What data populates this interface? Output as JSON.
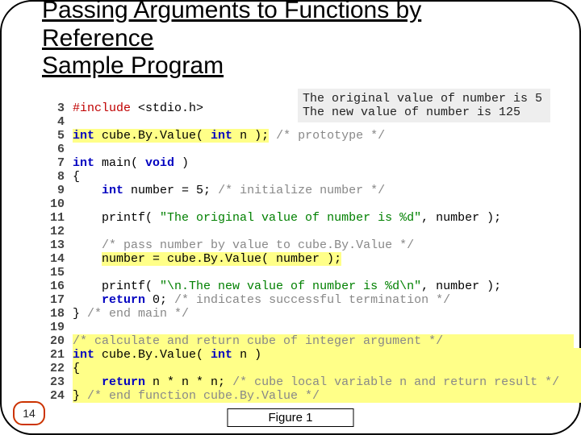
{
  "title": "Passing Arguments to Functions by\nReference\nSample Program",
  "output": "The original value of number is 5\nThe new value of number is 125",
  "page_number": "14",
  "figure_label": "Figure 1",
  "code_lines": [
    {
      "n": "3",
      "html": "<span class='tok-dir'>#include</span> &lt;stdio.h&gt;"
    },
    {
      "n": "4",
      "html": ""
    },
    {
      "n": "5",
      "html": "<span class='hl'><span class='tok-kw'>int</span> cube.By.Value( <span class='tok-kw'>int</span> n );</span> <span class='tok-comment'>/* prototype */</span>"
    },
    {
      "n": "6",
      "html": ""
    },
    {
      "n": "7",
      "html": "<span class='tok-kw'>int</span> main( <span class='tok-kw'>void</span> )"
    },
    {
      "n": "8",
      "html": "{"
    },
    {
      "n": "9",
      "html": "    <span class='tok-kw'>int</span> number = 5; <span class='tok-comment'>/* initialize number */</span>"
    },
    {
      "n": "10",
      "html": ""
    },
    {
      "n": "11",
      "html": "    printf( <span class='tok-str'>\"The original value of number is %d\"</span>, number );"
    },
    {
      "n": "12",
      "html": ""
    },
    {
      "n": "13",
      "html": "    <span class='tok-comment'>/* pass number by value to cube.By.Value */</span>"
    },
    {
      "n": "14",
      "html": "    <span class='hl'>number = cube.By.Value( number );</span>"
    },
    {
      "n": "15",
      "html": ""
    },
    {
      "n": "16",
      "html": "    printf( <span class='tok-str'>\"\\n.The new value of number is %d\\n\"</span>, number );"
    },
    {
      "n": "17",
      "html": "    <span class='tok-kw'>return</span> 0; <span class='tok-comment'>/* indicates successful termination */</span>"
    },
    {
      "n": "18",
      "html": "} <span class='tok-comment'>/* end main */</span>"
    },
    {
      "n": "19",
      "html": ""
    },
    {
      "n": "20",
      "html": "<span class='hl'><span class='tok-comment'>/* calculate and return cube of integer argument */</span>                  </span>"
    },
    {
      "n": "21",
      "html": "<span class='hl'><span class='tok-kw'>int</span> cube.By.Value( <span class='tok-kw'>int</span> n )                                             </span>"
    },
    {
      "n": "22",
      "html": "<span class='hl'>{                                                                      </span>"
    },
    {
      "n": "23",
      "html": "<span class='hl'>    <span class='tok-kw'>return</span> n * n * n; <span class='tok-comment'>/* cube local variable n and return result */</span>    </span>"
    },
    {
      "n": "24",
      "html": "<span class='hl'>} <span class='tok-comment'>/* end function cube.By.Value */</span>                                     </span>"
    }
  ]
}
